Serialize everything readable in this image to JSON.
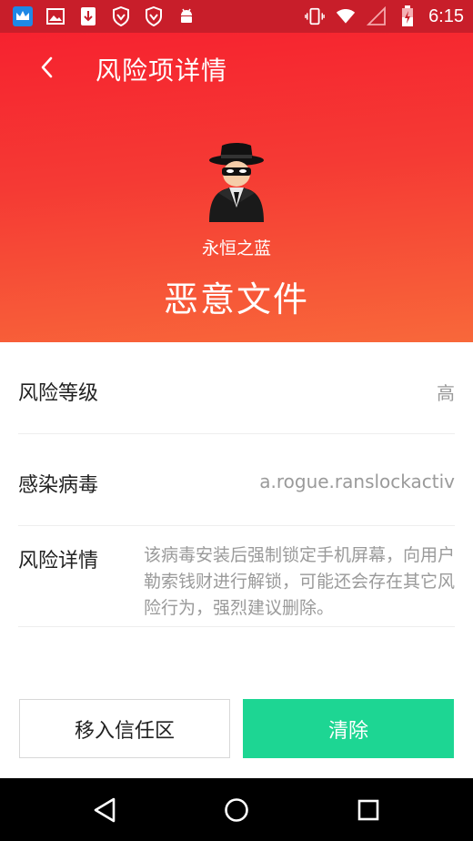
{
  "status_bar": {
    "time": "6:15",
    "left_icons": [
      "crown-app-icon",
      "image-icon",
      "download-icon",
      "shield-icon",
      "shield-icon",
      "android-icon"
    ],
    "right_icons": [
      "vibrate-icon",
      "wifi-icon",
      "signal-icon",
      "battery-charging-icon"
    ]
  },
  "header": {
    "title": "风险项详情",
    "app_name": "永恒之蓝",
    "risk_type": "恶意文件"
  },
  "details": {
    "level_label": "风险等级",
    "level_value": "高",
    "virus_label": "感染病毒",
    "virus_value": "a.rogue.ranslockactiv",
    "detail_label": "风险详情",
    "detail_value": "该病毒安装后强制锁定手机屏幕，向用户勒索钱财进行解锁，可能还会存在其它风险行为，强烈建议删除。"
  },
  "actions": {
    "trust_label": "移入信任区",
    "clean_label": "清除"
  },
  "colors": {
    "header_red": "#f6222f",
    "header_orange": "#f8683a",
    "clean_green": "#1dd693"
  }
}
